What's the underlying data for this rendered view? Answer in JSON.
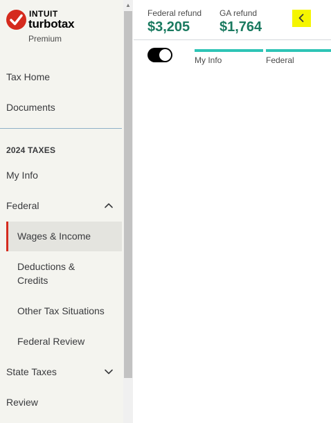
{
  "brand": {
    "company": "INTUIT",
    "product": "turbotax",
    "edition": "Premium"
  },
  "sidebar": {
    "top_items": [
      {
        "label": "Tax Home"
      },
      {
        "label": "Documents"
      }
    ],
    "section_title": "2024 TAXES",
    "items": [
      {
        "label": "My Info"
      },
      {
        "label": "Federal",
        "expanded": true
      },
      {
        "label": "Wages & Income",
        "active": true
      },
      {
        "label": "Deductions &"
      },
      {
        "label": "Credits"
      },
      {
        "label": "Other Tax Situations"
      },
      {
        "label": "Federal Review"
      },
      {
        "label": "State Taxes",
        "expanded": false
      },
      {
        "label": "Review"
      }
    ]
  },
  "header": {
    "federal_label": "Federal refund",
    "federal_value": "$3,205",
    "state_label": "GA refund",
    "state_value": "$1,764"
  },
  "progress": {
    "toggle_on": true,
    "steps": [
      {
        "label": "My Info",
        "complete": true
      },
      {
        "label": "Federal",
        "complete": true
      }
    ]
  },
  "colors": {
    "accent_red": "#d52b1e",
    "refund_green": "#1a7a60",
    "progress_teal": "#2ec4b6",
    "highlight_yellow": "#f5f500"
  }
}
